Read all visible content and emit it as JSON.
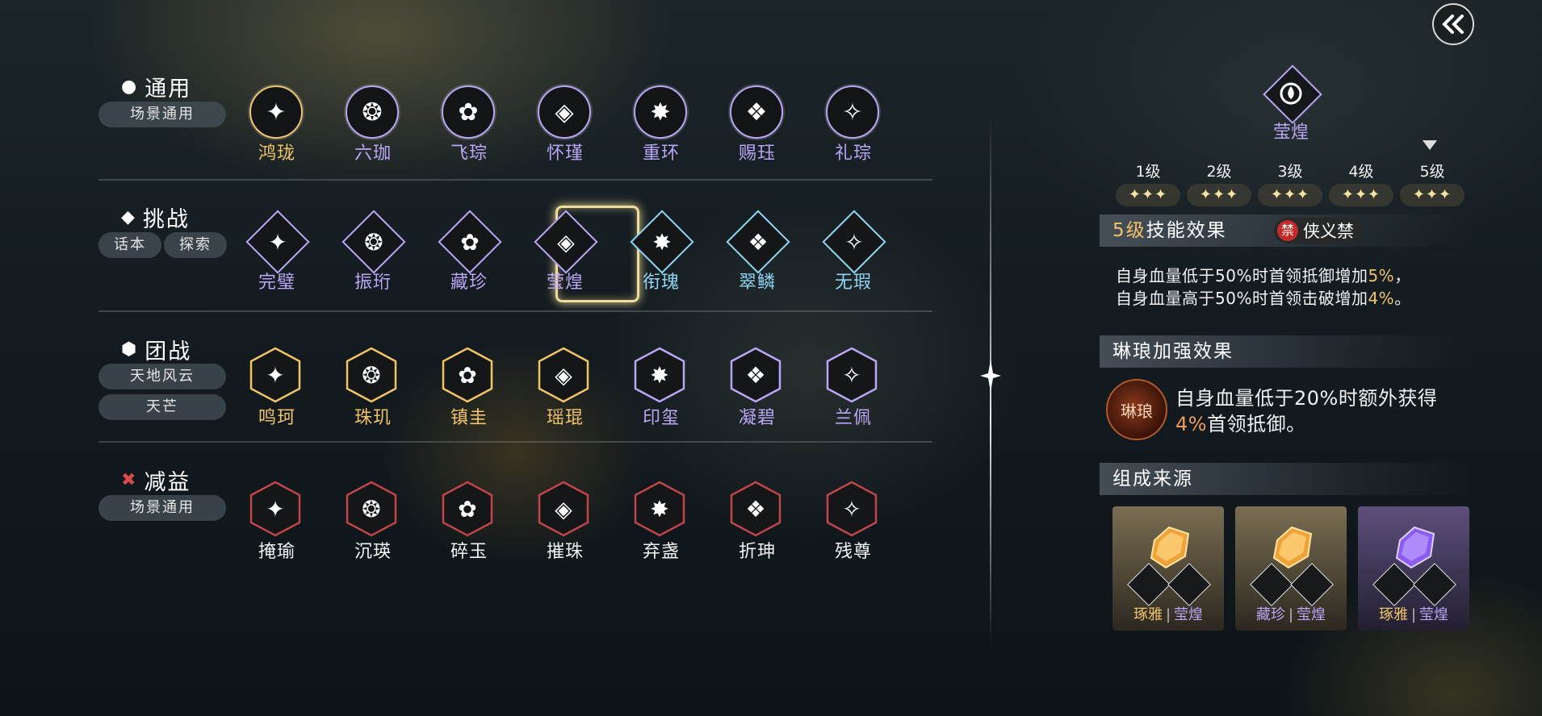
{
  "categories": [
    {
      "symbol": "●",
      "title": "通用",
      "tags": [
        "场景通用"
      ],
      "skills": [
        {
          "name": "鸿珑",
          "color": "gold"
        },
        {
          "name": "六珈",
          "color": "purple"
        },
        {
          "name": "飞琮",
          "color": "purple"
        },
        {
          "name": "怀瑾",
          "color": "purple"
        },
        {
          "name": "重环",
          "color": "purple"
        },
        {
          "name": "赐珏",
          "color": "purple"
        },
        {
          "name": "礼琮",
          "color": "purple"
        }
      ]
    },
    {
      "symbol": "◆",
      "title": "挑战",
      "tags": [
        "话本",
        "探索"
      ],
      "skills": [
        {
          "name": "完璧",
          "color": "purple"
        },
        {
          "name": "振珩",
          "color": "purple"
        },
        {
          "name": "藏珍",
          "color": "purple"
        },
        {
          "name": "莹煌",
          "color": "purple"
        },
        {
          "name": "衔瑰",
          "color": "blue"
        },
        {
          "name": "翠鳞",
          "color": "blue"
        },
        {
          "name": "无瑕",
          "color": "blue"
        }
      ]
    },
    {
      "symbol": "⬢",
      "title": "团战",
      "tags": [
        "天地风云",
        "天芒"
      ],
      "skills": [
        {
          "name": "鸣珂",
          "color": "gold"
        },
        {
          "name": "珠玑",
          "color": "gold"
        },
        {
          "name": "镇圭",
          "color": "gold"
        },
        {
          "name": "瑶琨",
          "color": "gold"
        },
        {
          "name": "印玺",
          "color": "purple"
        },
        {
          "name": "凝碧",
          "color": "purple"
        },
        {
          "name": "兰佩",
          "color": "purple"
        }
      ]
    },
    {
      "symbol": "✖",
      "title": "减益",
      "tags": [
        "场景通用"
      ],
      "skills": [
        {
          "name": "掩瑜",
          "color": "white"
        },
        {
          "name": "沉瑛",
          "color": "white"
        },
        {
          "name": "碎玉",
          "color": "white"
        },
        {
          "name": "摧珠",
          "color": "white"
        },
        {
          "name": "弃盏",
          "color": "white"
        },
        {
          "name": "折珅",
          "color": "white"
        },
        {
          "name": "残尊",
          "color": "white"
        }
      ]
    }
  ],
  "selected_skill": "莹煌",
  "detail": {
    "name": "莹煌",
    "levels": [
      "1级",
      "2级",
      "3级",
      "4级",
      "5级"
    ],
    "stars_per_level": "✦✦✦",
    "current_level_index": 4,
    "effect_header_level": "5级",
    "effect_header_text": "技能效果",
    "restriction_badge": "禁",
    "restriction_label": "侠义禁",
    "effect_line1_pre": "自身血量低于50%时首领抵御增加",
    "effect_line1_val": "5%",
    "effect_line1_post": "，",
    "effect_line2_pre": "自身血量高于50%时首领击破增加",
    "effect_line2_val": "4%",
    "effect_line2_post": "。",
    "boost_header": "琳琅加强效果",
    "boost_emblem": "琳琅",
    "boost_line1": "自身血量低于20%时额外获得",
    "boost_val": "4%",
    "boost_line2": "首领抵御。",
    "source_header": "组成来源",
    "sources": [
      {
        "left": "琢雅",
        "sep": "|",
        "right": "莹煌",
        "gem": "orange"
      },
      {
        "left": "藏珍",
        "sep": "|",
        "right": "莹煌",
        "gem": "orange"
      },
      {
        "left": "琢雅",
        "sep": "|",
        "right": "莹煌",
        "gem": "purple"
      }
    ]
  },
  "colors": {
    "gold": "#f0c469",
    "purple": "#b9a6f4",
    "blue": "#8fd6f2",
    "orange": "#f29a55"
  }
}
